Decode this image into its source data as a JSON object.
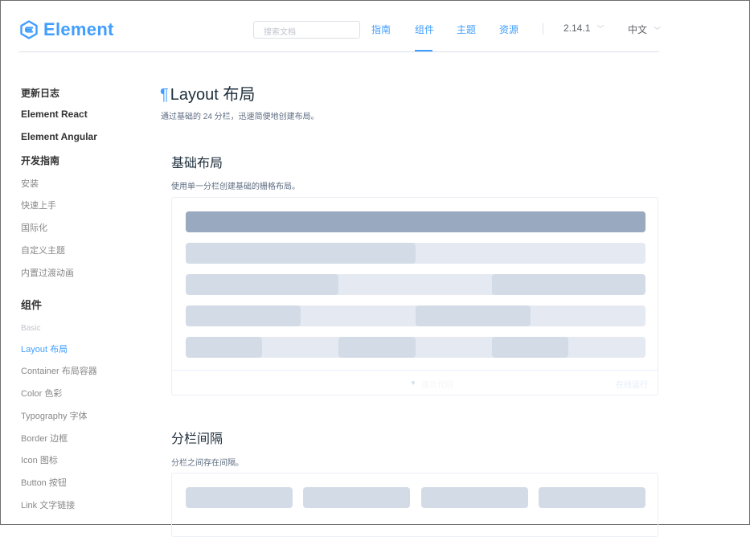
{
  "header": {
    "logo_text": "Element",
    "search_placeholder": "搜索文档",
    "nav": [
      "指南",
      "组件",
      "主题",
      "资源"
    ],
    "active_nav": "组件",
    "version": "2.14.1",
    "language": "中文"
  },
  "sidebar": {
    "items": [
      {
        "label": "更新日志",
        "kind": "group"
      },
      {
        "label": "Element React",
        "kind": "group"
      },
      {
        "label": "Element Angular",
        "kind": "group"
      },
      {
        "label": "开发指南",
        "kind": "group"
      },
      {
        "label": "安装",
        "kind": "sub"
      },
      {
        "label": "快速上手",
        "kind": "sub"
      },
      {
        "label": "国际化",
        "kind": "sub"
      },
      {
        "label": "自定义主题",
        "kind": "sub"
      },
      {
        "label": "内置过渡动画",
        "kind": "sub"
      },
      {
        "label": "组件",
        "kind": "big"
      },
      {
        "label": "Basic",
        "kind": "basic"
      },
      {
        "label": "Layout 布局",
        "kind": "active"
      },
      {
        "label": "Container 布局容器",
        "kind": "sub"
      },
      {
        "label": "Color 色彩",
        "kind": "sub"
      },
      {
        "label": "Typography 字体",
        "kind": "sub"
      },
      {
        "label": "Border 边框",
        "kind": "sub"
      },
      {
        "label": "Icon 图标",
        "kind": "sub"
      },
      {
        "label": "Button 按钮",
        "kind": "sub"
      },
      {
        "label": "Link 文字链接",
        "kind": "sub"
      }
    ]
  },
  "main": {
    "anchor": "¶",
    "title": "Layout 布局",
    "intro": "通过基础的 24 分栏，迅速简便地创建布局。",
    "section1": {
      "title": "基础布局",
      "desc": "使用单一分栏创建基础的栅格布局。",
      "footer_hint": "显示代码",
      "footer_run": "在线运行"
    },
    "section2": {
      "title": "分栏间隔",
      "desc": "分栏之间存在间隔。"
    }
  },
  "colors": {
    "accent": "#409eff",
    "col_dark": "#99a9bf",
    "col_mid": "#d3dce6",
    "col_light": "#e5e9f2"
  }
}
